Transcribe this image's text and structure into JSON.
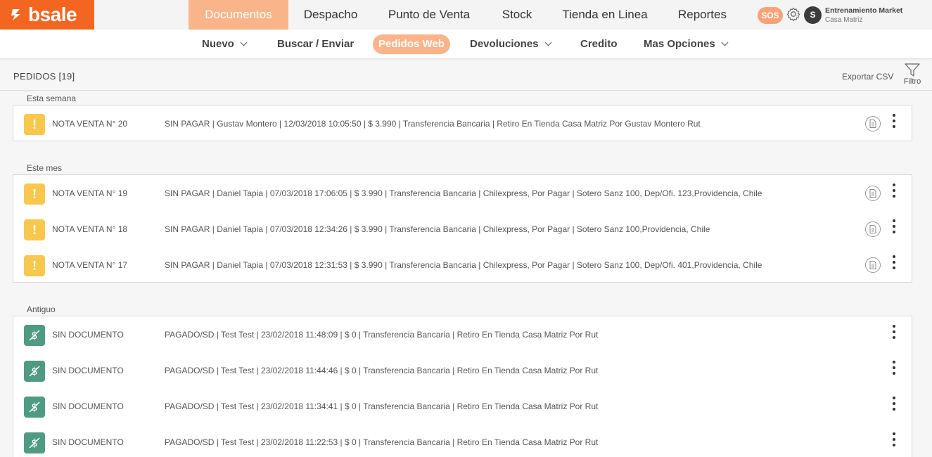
{
  "brand": {
    "name": "bsale",
    "accent": "#f26622"
  },
  "main_nav": {
    "items": [
      "Documentos",
      "Despacho",
      "Punto de Venta",
      "Stock",
      "Tienda en Linea",
      "Reportes"
    ],
    "active": "Documentos"
  },
  "header": {
    "sos_label": "SOS",
    "avatar_initial": "S",
    "user_name": "Entrenamiento Market",
    "user_branch": "Casa Matriz"
  },
  "sub_nav": {
    "items": [
      "Nuevo",
      "Buscar / Enviar",
      "Pedidos Web",
      "Devoluciones",
      "Credito",
      "Mas Opciones"
    ],
    "active": "Pedidos Web"
  },
  "page": {
    "title": "PEDIDOS [19]",
    "export_label": "Exportar CSV",
    "filter_label": "Filtro"
  },
  "sections": [
    {
      "label": "Esta semana",
      "rows": [
        {
          "status": "warn",
          "doc": "NOTA VENTA N° 20",
          "detail": "SIN PAGAR | Gustav Montero | 12/03/2018 10:05:50 | $ 3.990 | Transferencia Bancaria | Retiro En Tienda Casa Matriz Por Gustav Montero Rut"
        }
      ]
    },
    {
      "label": "Este mes",
      "rows": [
        {
          "status": "warn",
          "doc": "NOTA VENTA N° 19",
          "detail": "SIN PAGAR | Daniel Tapia | 07/03/2018 17:06:05 | $ 3.990 | Transferencia Bancaria | Chilexpress, Por Pagar | Sotero Sanz 100, Dep/Ofi. 123,Providencia, Chile"
        },
        {
          "status": "warn",
          "doc": "NOTA VENTA N° 18",
          "detail": "SIN PAGAR | Daniel Tapia | 07/03/2018 12:34:26 | $ 3.990 | Transferencia Bancaria | Chilexpress, Por Pagar | Sotero Sanz 100,Providencia, Chile"
        },
        {
          "status": "warn",
          "doc": "NOTA VENTA N° 17",
          "detail": "SIN PAGAR | Daniel Tapia | 07/03/2018 12:31:53 | $ 3.990 | Transferencia Bancaria | Chilexpress, Por Pagar | Sotero Sanz 100, Dep/Ofi. 401,Providencia, Chile"
        }
      ]
    },
    {
      "label": "Antiguo",
      "rows": [
        {
          "status": "paid",
          "doc": "SIN DOCUMENTO",
          "detail": "PAGADO/SD | Test Test | 23/02/2018 11:48:09 | $ 0 | Transferencia Bancaria | Retiro En Tienda Casa Matriz Por Rut"
        },
        {
          "status": "paid",
          "doc": "SIN DOCUMENTO",
          "detail": "PAGADO/SD | Test Test | 23/02/2018 11:44:46 | $ 0 | Transferencia Bancaria | Retiro En Tienda Casa Matriz Por Rut"
        },
        {
          "status": "paid",
          "doc": "SIN DOCUMENTO",
          "detail": "PAGADO/SD | Test Test | 23/02/2018 11:34:41 | $ 0 | Transferencia Bancaria | Retiro En Tienda Casa Matriz Por Rut"
        },
        {
          "status": "paid",
          "doc": "SIN DOCUMENTO",
          "detail": "PAGADO/SD | Test Test | 23/02/2018 11:22:53 | $ 0 | Transferencia Bancaria | Retiro En Tienda Casa Matriz Por Rut"
        }
      ]
    }
  ]
}
